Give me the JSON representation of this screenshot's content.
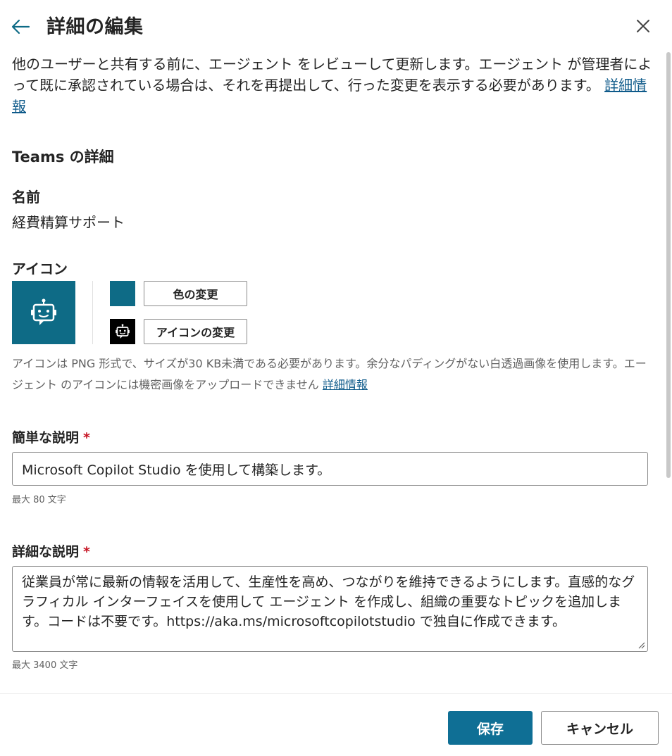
{
  "header": {
    "title": "詳細の編集",
    "back_icon": "arrow-left-icon",
    "close_icon": "close-icon"
  },
  "intro": {
    "text": "他のユーザーと共有する前に、エージェント をレビューして更新します。エージェント が管理者によって既に承認されている場合は、それを再提出して、行った変更を表示する必要があります。 ",
    "link": "詳細情報"
  },
  "teams": {
    "section_title": "Teams の詳細",
    "name_label": "名前",
    "name_value": "経費精算サポート"
  },
  "icon_section": {
    "label": "アイコン",
    "color_button": "色の変更",
    "icon_button": "アイコンの変更",
    "color": "#0e6b86",
    "help_text": "アイコンは PNG 形式で、サイズが30 KB未満である必要があります。余分なパディングがない白透過画像を使用します。エージェント のアイコンには機密画像をアップロードできません ",
    "help_link": "詳細情報",
    "preview_icon": "bot-icon"
  },
  "short_description": {
    "label": "簡単な説明",
    "required_mark": "*",
    "value": "Microsoft Copilot Studio を使用して構築します。",
    "hint": "最大 80 文字"
  },
  "long_description": {
    "label": "詳細な説明",
    "required_mark": "*",
    "value": "従業員が常に最新の情報を活用して、生産性を高め、つながりを維持できるようにします。直感的なグラフィカル インターフェイスを使用して エージェント を作成し、組織の重要なトピックを追加します。コードは不要です。https://aka.ms/microsoftcopilotstudio で独自に作成できます。",
    "hint": "最大 3400 文字"
  },
  "footer": {
    "save_label": "保存",
    "cancel_label": "キャンセル",
    "primary_color": "#0f6f95"
  }
}
